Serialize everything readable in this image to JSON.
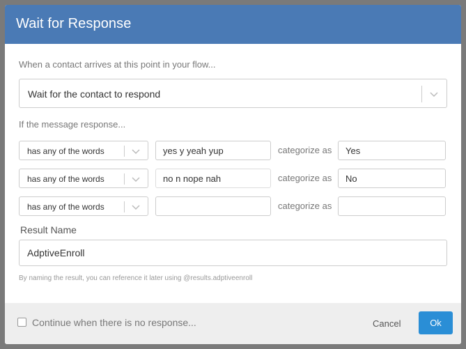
{
  "dialog": {
    "title": "Wait for Response",
    "intro": "When a contact arrives at this point in your flow...",
    "action_select": {
      "value": "Wait for the contact to respond",
      "icon": "chevron-down-icon"
    },
    "if_label": "If the message response...",
    "rules": [
      {
        "operator": "has any of the words",
        "words": "yes y yeah yup",
        "category_label": "categorize as",
        "category": "Yes"
      },
      {
        "operator": "has any of the words",
        "words": "no n nope nah",
        "category_label": "categorize as",
        "category": "No"
      },
      {
        "operator": "has any of the words",
        "words": "",
        "category_label": "categorize as",
        "category": ""
      }
    ],
    "result_name_label": "Result Name",
    "result_name_value": "AdptiveEnroll",
    "hint": "By naming the result, you can reference it later using @results.adptiveenroll"
  },
  "footer": {
    "checkbox_label": "Continue when there is no response...",
    "checkbox_checked": false,
    "cancel_label": "Cancel",
    "ok_label": "Ok"
  },
  "colors": {
    "header": "#4a7ab5",
    "primary_button": "#2a8ed6",
    "footer_bg": "#eeeeee",
    "backdrop": "#7a7a7a"
  }
}
